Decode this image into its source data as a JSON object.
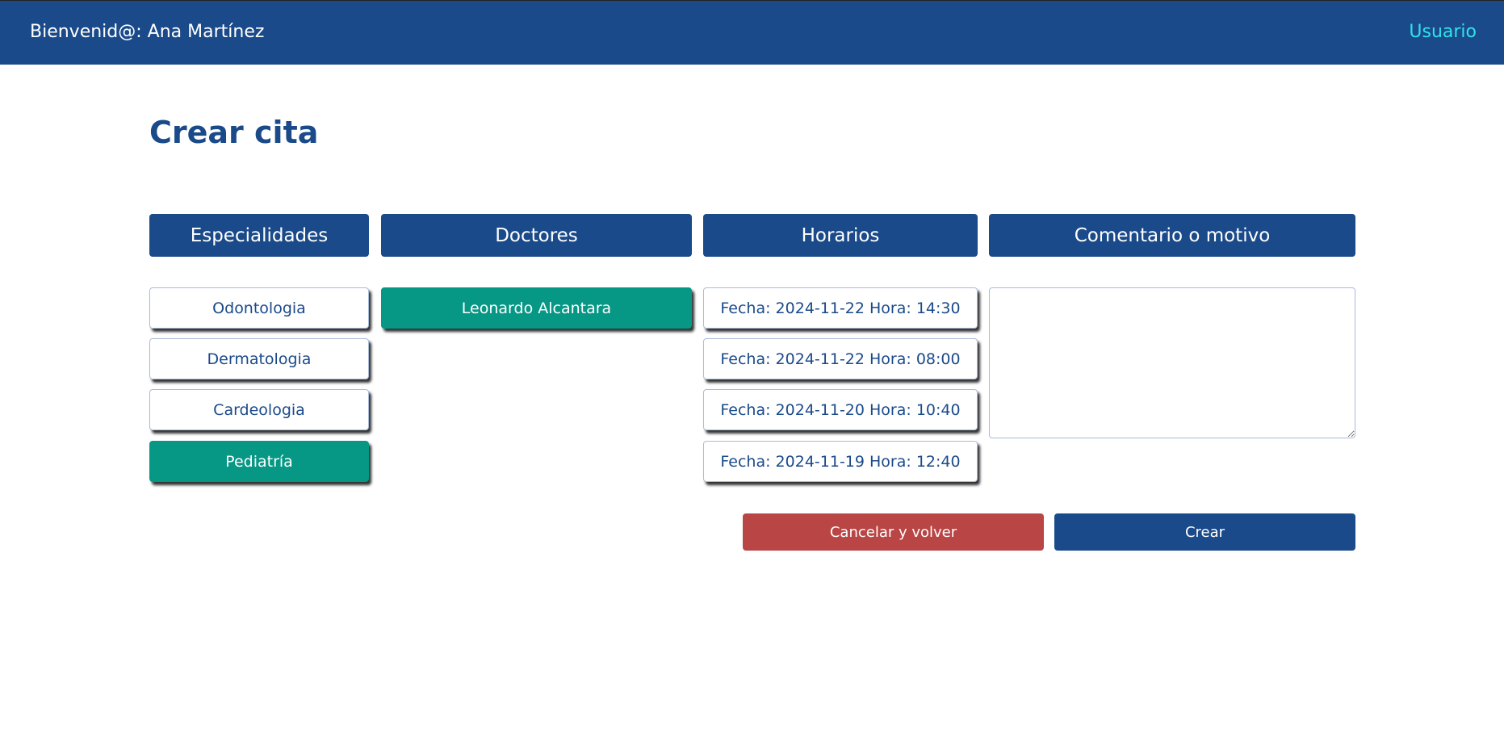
{
  "header": {
    "welcome": "Bienvenid@: Ana Martínez",
    "user_link": "Usuario"
  },
  "page_title": "Crear cita",
  "columns": {
    "especialidades": "Especialidades",
    "doctores": "Doctores",
    "horarios": "Horarios",
    "comentario": "Comentario o motivo"
  },
  "especialidades": [
    {
      "label": "Odontologia",
      "selected": false
    },
    {
      "label": "Dermatologia",
      "selected": false
    },
    {
      "label": "Cardeologia",
      "selected": false
    },
    {
      "label": "Pediatría",
      "selected": true
    }
  ],
  "doctores": [
    {
      "label": "Leonardo Alcantara",
      "selected": true
    }
  ],
  "horarios": [
    {
      "label": "Fecha: 2024-11-22 Hora: 14:30"
    },
    {
      "label": "Fecha: 2024-11-22 Hora: 08:00"
    },
    {
      "label": "Fecha: 2024-11-20 Hora: 10:40"
    },
    {
      "label": "Fecha: 2024-11-19 Hora: 12:40"
    }
  ],
  "comment_value": "",
  "actions": {
    "cancel": "Cancelar y volver",
    "create": "Crear"
  },
  "colors": {
    "primary": "#1a4a8a",
    "selected": "#079785",
    "danger": "#b94545",
    "user_link": "#2fe3ea"
  }
}
